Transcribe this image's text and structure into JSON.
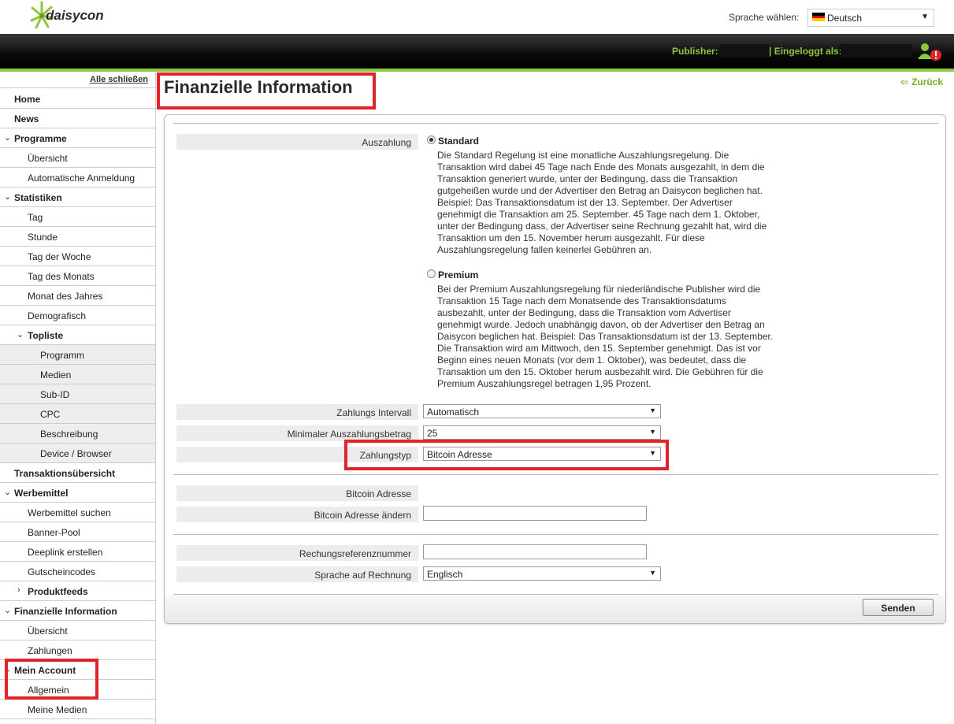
{
  "header": {
    "brand": "daisycon",
    "language_label": "Sprache wählen:",
    "language_value": "Deutsch",
    "publisher_label": "Publisher:",
    "logged_in_label": "| Eingeloggt als:"
  },
  "sidebar": {
    "collapse_all": "Alle schließen",
    "items": [
      {
        "label": "Home"
      },
      {
        "label": "News"
      },
      {
        "label": "Programme"
      },
      {
        "label": "Übersicht"
      },
      {
        "label": "Automatische Anmeldung"
      },
      {
        "label": "Statistiken"
      },
      {
        "label": "Tag"
      },
      {
        "label": "Stunde"
      },
      {
        "label": "Tag der Woche"
      },
      {
        "label": "Tag des Monats"
      },
      {
        "label": "Monat des Jahres"
      },
      {
        "label": "Demografisch"
      },
      {
        "label": "Topliste"
      },
      {
        "label": "Programm"
      },
      {
        "label": "Medien"
      },
      {
        "label": "Sub-ID"
      },
      {
        "label": "CPC"
      },
      {
        "label": "Beschreibung"
      },
      {
        "label": "Device / Browser"
      },
      {
        "label": "Transaktionsübersicht"
      },
      {
        "label": "Werbemittel"
      },
      {
        "label": "Werbemittel suchen"
      },
      {
        "label": "Banner-Pool"
      },
      {
        "label": "Deeplink erstellen"
      },
      {
        "label": "Gutscheincodes"
      },
      {
        "label": "Produktfeeds"
      },
      {
        "label": "Finanzielle Information"
      },
      {
        "label": "Übersicht"
      },
      {
        "label": "Zahlungen"
      },
      {
        "label": "Mein Account"
      },
      {
        "label": "Allgemein"
      },
      {
        "label": "Meine Medien"
      }
    ]
  },
  "main": {
    "title": "Finanzielle Information",
    "back_link": "Zurück",
    "payout": {
      "label": "Auszahlung",
      "standard_title": "Standard",
      "standard_desc": "Die Standard Regelung ist eine monatliche Auszahlungsregelung. Die Transaktion wird dabei 45 Tage nach Ende des Monats ausgezahlt, in dem die Transaktion generiert wurde, unter der Bedingung, dass die Transaktion gutgeheißen wurde und der Advertiser den Betrag an Daisycon beglichen hat. Beispiel: Das Transaktionsdatum ist der 13. September. Der Advertiser genehmigt die Transaktion am 25. September. 45 Tage nach dem 1. Oktober, unter der Bedingung dass, der Advertiser seine Rechnung gezahlt hat, wird die Transaktion um den 15. November herum ausgezahlt. Für diese Auszahlungsregelung fallen keinerlei Gebühren an.",
      "premium_title": "Premium",
      "premium_desc": "Bei der Premium Auszahlungsregelung für niederländische Publisher wird die Transaktion 15 Tage nach dem Monatsende des Transaktionsdatums ausbezahlt, unter der Bedingung, dass die Transaktion vom Advertiser genehmigt wurde. Jedoch unabhängig davon, ob der Advertiser den Betrag an Daisycon beglichen hat. Beispiel: Das Transaktionsdatum ist der 13. September. Die Transaktion wird am Mittwoch, den 15. September genehmigt. Das ist vor Beginn eines neuen Monats (vor dem 1. Oktober), was bedeutet, dass die Transaktion um den 15. Oktober herum ausbezahlt wird. Die Gebühren für die Premium Auszahlungsregel betragen 1,95 Prozent."
    },
    "interval_label": "Zahlungs Intervall",
    "interval_value": "Automatisch",
    "min_amount_label": "Minimaler Auszahlungsbetrag",
    "min_amount_value": "25",
    "payment_type_label": "Zahlungstyp",
    "payment_type_value": "Bitcoin Adresse",
    "bitcoin_label": "Bitcoin Adresse",
    "bitcoin_change_label": "Bitcoin Adresse ändern",
    "bitcoin_change_value": "",
    "invoice_ref_label": "Rechungsreferenznummer",
    "invoice_ref_value": "",
    "invoice_lang_label": "Sprache auf Rechnung",
    "invoice_lang_value": "Englisch",
    "submit_label": "Senden"
  },
  "colors": {
    "accent_green": "#8dc63f",
    "highlight_red": "#e0242a"
  }
}
